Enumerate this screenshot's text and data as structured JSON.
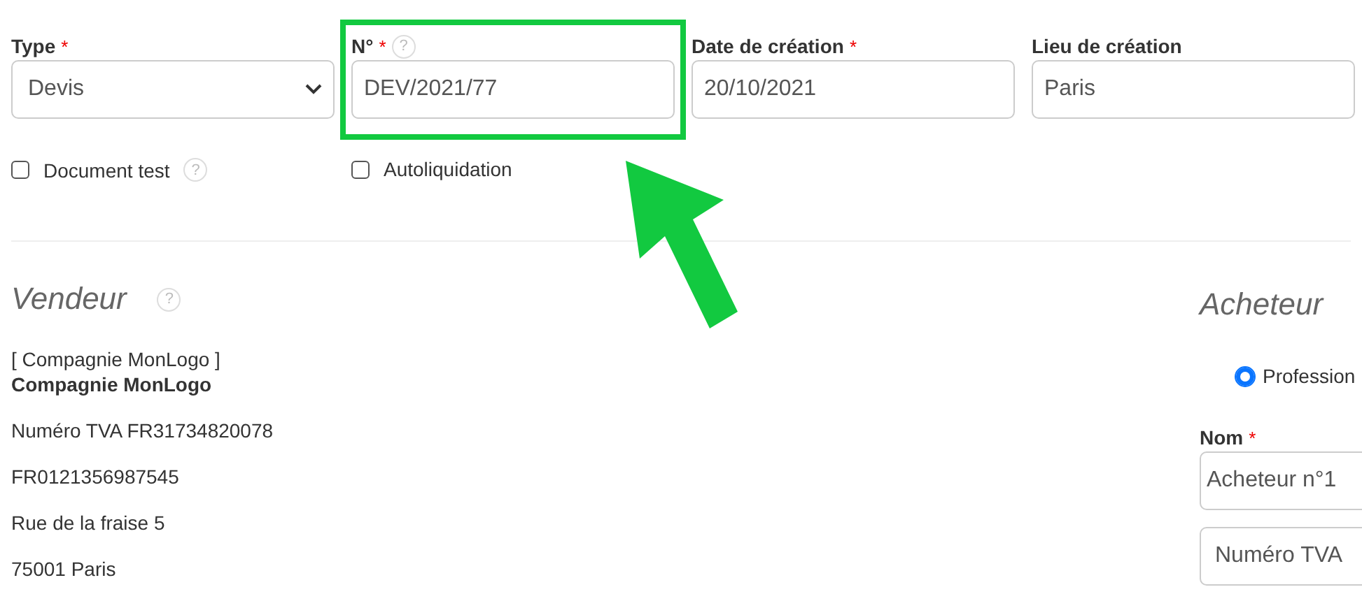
{
  "fields": [
    {
      "kind": "select",
      "label": "Type",
      "required_mark": "*",
      "value": "Devis",
      "highlighted": false
    },
    {
      "kind": "text",
      "label": "N°",
      "required_mark": "*",
      "help": "?",
      "value": "DEV/2021/77",
      "highlighted": true
    },
    {
      "kind": "text",
      "label": "Date de création",
      "required_mark": "*",
      "value": "20/10/2021",
      "highlighted": false
    },
    {
      "kind": "text",
      "label": "Lieu de création",
      "value": "Paris",
      "highlighted": false
    }
  ],
  "checkboxes": [
    {
      "label": "Document test",
      "checked": false,
      "help": "?"
    },
    {
      "label": "Autoliquidation",
      "checked": false
    }
  ],
  "seller": {
    "title": "Vendeur",
    "help": "?",
    "reference": "[ Compagnie MonLogo ]",
    "name": "Compagnie MonLogo",
    "lines": [
      "Numéro TVA FR31734820078",
      "FR0121356987545",
      "Rue de la fraise 5",
      "75001 Paris"
    ]
  },
  "buyer": {
    "title": "Acheteur",
    "radio": {
      "label": "Profession",
      "selected": true
    },
    "name_label": "Nom",
    "name_required_mark": "*",
    "name_value": "Acheteur n°1",
    "vat_placeholder": "Numéro TVA"
  }
}
